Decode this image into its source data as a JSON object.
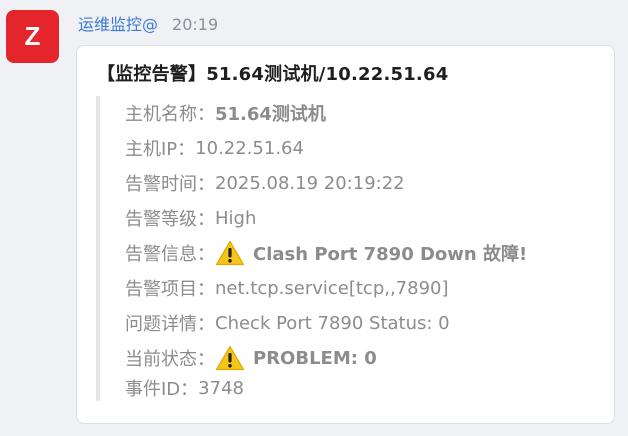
{
  "sender": {
    "avatar_letter": "Z",
    "name": "运维监控@",
    "time": "20:19"
  },
  "message": {
    "title": "【监控告警】51.64测试机/10.22.51.64",
    "fields": [
      {
        "label": "主机名称：",
        "value": "51.64测试机",
        "bold": true
      },
      {
        "label": "主机IP：",
        "value": "10.22.51.64"
      },
      {
        "label": "告警时间：",
        "value": "2025.08.19 20:19:22"
      },
      {
        "label": "告警等级：",
        "value": "High"
      },
      {
        "label": "告警信息：",
        "value": "Clash Port 7890 Down 故障!",
        "bold": true,
        "icon": "warning-icon"
      },
      {
        "label": "告警项目：",
        "value": "net.tcp.service[tcp,,7890]"
      },
      {
        "label": "问题详情：",
        "value": "Check Port 7890 Status: 0"
      },
      {
        "label": "当前状态：",
        "value": "PROBLEM: 0",
        "bold": true,
        "icon": "warning-icon"
      },
      {
        "label": "事件ID：",
        "value": "3748"
      }
    ]
  },
  "colors": {
    "avatar_bg": "#e5252c",
    "sender_name": "#3a7bd5",
    "warning_yellow": "#f5c518"
  }
}
